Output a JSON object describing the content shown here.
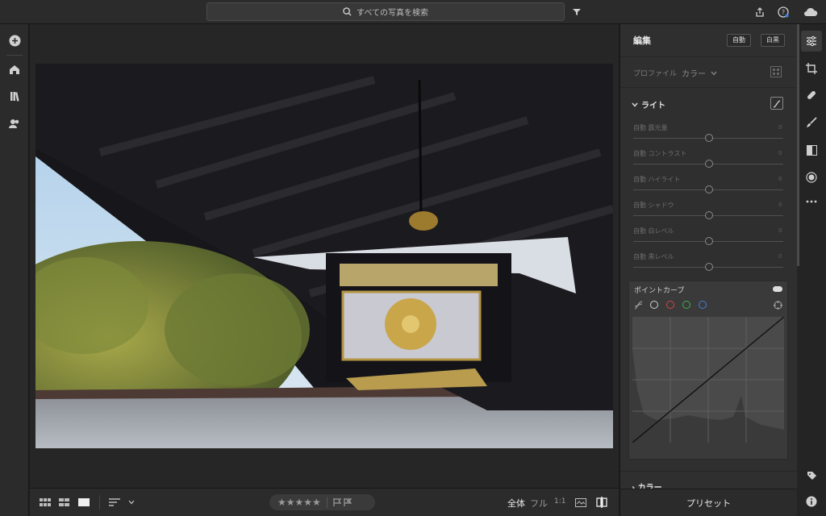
{
  "search": {
    "placeholder": "すべての写真を検索"
  },
  "icons": {
    "search": "search-icon",
    "filter": "filter-icon",
    "share": "share-icon",
    "help": "help-icon",
    "cloud": "cloud-icon",
    "add": "plus-icon",
    "home": "home-icon",
    "library": "library-icon",
    "people": "people-icon"
  },
  "edit_panel": {
    "title": "編集",
    "auto_label": "自動",
    "bw_label": "白黒",
    "profile_label": "プロファイル",
    "profile_value": "カラー",
    "light_section": "ライト",
    "sliders": [
      {
        "label": "自動 露光量",
        "value": "0"
      },
      {
        "label": "自動 コントラスト",
        "value": "0"
      },
      {
        "label": "自動 ハイライト",
        "value": "0"
      },
      {
        "label": "自動 シャドウ",
        "value": "0"
      },
      {
        "label": "自動 白レベル",
        "value": "0"
      },
      {
        "label": "自動 黒レベル",
        "value": "0"
      }
    ],
    "point_curve_title": "ポイントカーブ",
    "color_section": "カラー"
  },
  "bottom_bar": {
    "stars": "★★★★★",
    "zoom_fit": "全体",
    "zoom_fill": "フル",
    "zoom_1to1": "1:1"
  },
  "presets_label": "プリセット",
  "colors": {
    "accent": "#e8e8e8",
    "red": "#d04545",
    "green": "#3fae4f",
    "blue": "#3f7fd6"
  }
}
